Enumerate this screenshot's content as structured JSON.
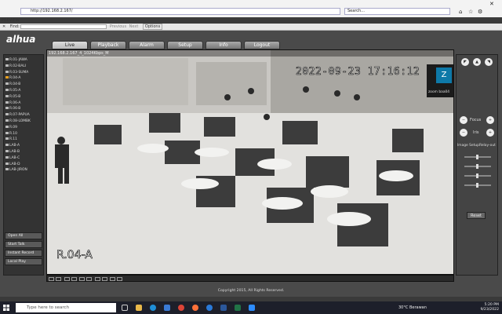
{
  "browser": {
    "url": "http://192.168.2.167/",
    "search_placeholder": "Search...",
    "tab": "PREVIEW",
    "find_label": "Find:",
    "find_prev": "Previous",
    "find_next": "Next",
    "find_options": "Options"
  },
  "app": {
    "logo": "alhua",
    "tabs": [
      "Live",
      "Playback",
      "Alarm",
      "Setup",
      "Info",
      "Logout"
    ],
    "cameras": [
      "R.01-JAWA",
      "R.02-BALI",
      "R.03-SUMA",
      "R.04-A",
      "R.04-B",
      "R.05-A",
      "R.05-B",
      "R.06-A",
      "R.06-B",
      "R.07-PAPUA",
      "R.08-LOMBK",
      "R.09",
      "R.10",
      "R.11",
      "LAB-A",
      "LAB-B",
      "LAB-C",
      "LAB-D",
      "LAB-JIRON"
    ],
    "left_buttons": [
      "Open All",
      "Start Talk",
      "Instant Record",
      "Local Play"
    ],
    "video": {
      "title": "192.168.2.167_4_1024Kbps_M",
      "timestamp": "2022-09-23 17:16:12",
      "camera_name": "R.04-A",
      "zoom_letter": "Z",
      "zoom_label": "zoom baa04"
    },
    "ptz": {
      "focus": "Focus",
      "iris": "Iris",
      "image_setup": "Image Setup",
      "relay": "Relay-out",
      "reset": "Reset"
    },
    "copyright": "Copyright 2015, All Rights Reserved."
  },
  "taskbar": {
    "search_placeholder": "Type here to search",
    "weather": "30°C Berawan",
    "time": "5:20 PM",
    "date": "9/23/2022"
  }
}
